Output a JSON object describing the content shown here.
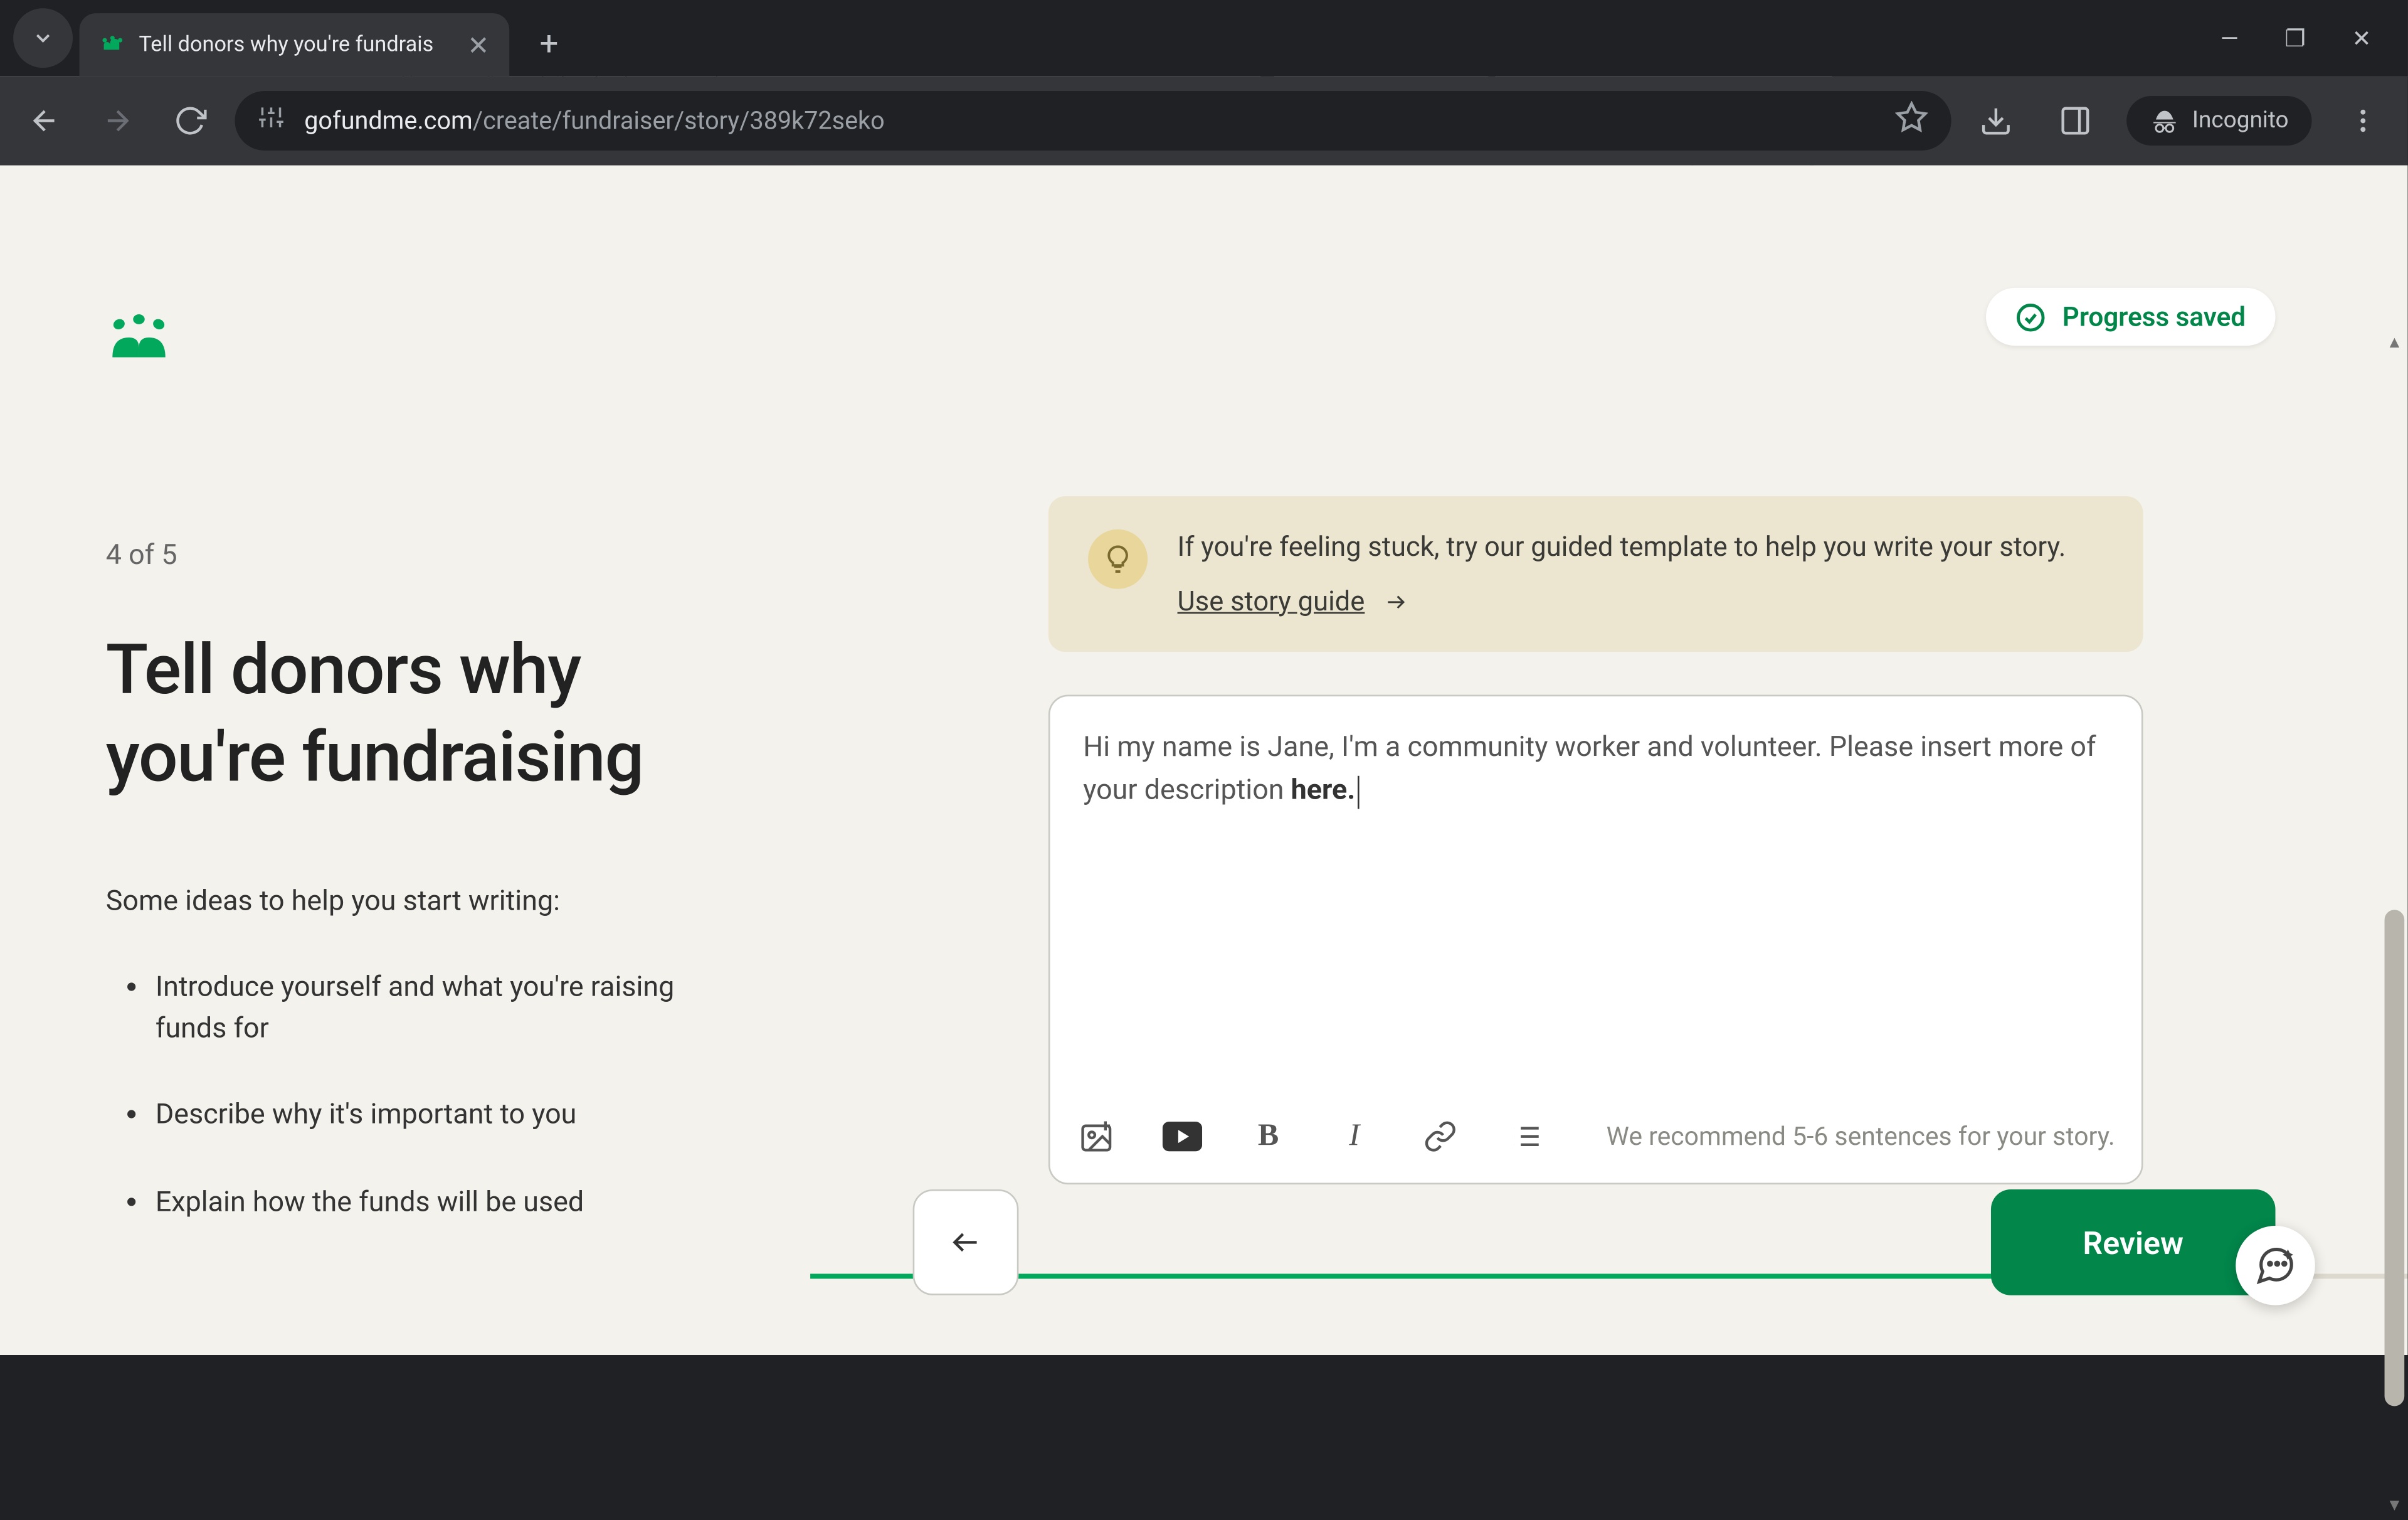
{
  "browser": {
    "tab_title": "Tell donors why you're fundrais",
    "url_domain": "gofundme.com",
    "url_path": "/create/fundraiser/story/389k72seko",
    "incognito_label": "Incognito"
  },
  "sidebar": {
    "step": "4 of 5",
    "heading": "Tell donors why you're fundraising",
    "sub": "Some ideas to help you start writing:",
    "ideas": [
      "Introduce yourself and what you're raising funds for",
      "Describe why it's important to you",
      "Explain how the funds will be used"
    ]
  },
  "progress": {
    "label": "Progress saved"
  },
  "hint": {
    "text": "If you're feeling stuck, try our guided template to help you write your story.",
    "link": "Use story guide"
  },
  "editor": {
    "text_plain": "Hi my name is Jane, I'm a community worker and volunteer. Please insert more of your description ",
    "text_bold": "here.",
    "toolbar_hint": "We recommend 5-6 sentences for your story."
  },
  "footer": {
    "review": "Review"
  }
}
